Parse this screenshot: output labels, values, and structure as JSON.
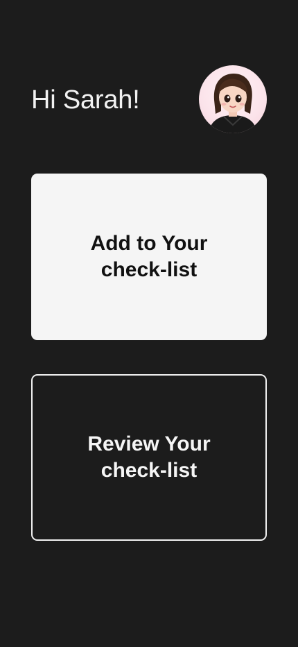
{
  "header": {
    "greeting": "Hi Sarah!"
  },
  "avatar": {
    "icon": "user-avatar-icon"
  },
  "cards": {
    "add": {
      "label": "Add to Your\ncheck-list"
    },
    "review": {
      "label": "Review Your\ncheck-list"
    }
  },
  "colors": {
    "background": "#1c1c1c",
    "card_light": "#f5f5f5",
    "text_light": "#f2f2f2",
    "text_dark": "#111111"
  }
}
